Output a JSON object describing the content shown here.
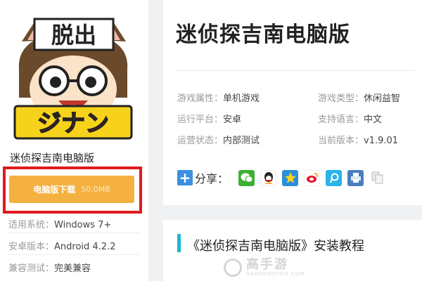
{
  "app": {
    "name": "迷侦探吉南电脑版",
    "icon_text_top": "脱出",
    "icon_text_bottom": "ジナン"
  },
  "download": {
    "label": "电脑版下载",
    "size": "50.0MB"
  },
  "meta": [
    {
      "key": "适用系统：",
      "value": "Windows 7+"
    },
    {
      "key": "安卓版本：",
      "value": "Android 4.2.2"
    },
    {
      "key": "兼容测试：",
      "value": "完美兼容"
    }
  ],
  "header": {
    "title": "迷侦探吉南电脑版"
  },
  "attributes": [
    {
      "key": "游戏属性：",
      "value": "单机游戏"
    },
    {
      "key": "游戏类型：",
      "value": "休闲益智"
    },
    {
      "key": "运行平台：",
      "value": "安卓"
    },
    {
      "key": "支持语言：",
      "value": "中文"
    },
    {
      "key": "运营状态：",
      "value": "内部测试"
    },
    {
      "key": "当前版本：",
      "value": "v1.9.01"
    }
  ],
  "share": {
    "label": "分享：",
    "icons": [
      "wechat-icon",
      "qq-icon",
      "qzone-icon",
      "weibo-icon",
      "tencent-weibo-icon",
      "print-icon",
      "copy-icon"
    ]
  },
  "section": {
    "title": "《迷侦探吉南电脑版》安装教程"
  },
  "watermark": {
    "main": "高手游",
    "sub": "GAOSHOUYOU.COM"
  },
  "colors": {
    "download_button": "#f5b13f",
    "highlight_border": "#e0191c",
    "accent_bar": "#1bb6d3",
    "plus": "#3d8fe0"
  }
}
